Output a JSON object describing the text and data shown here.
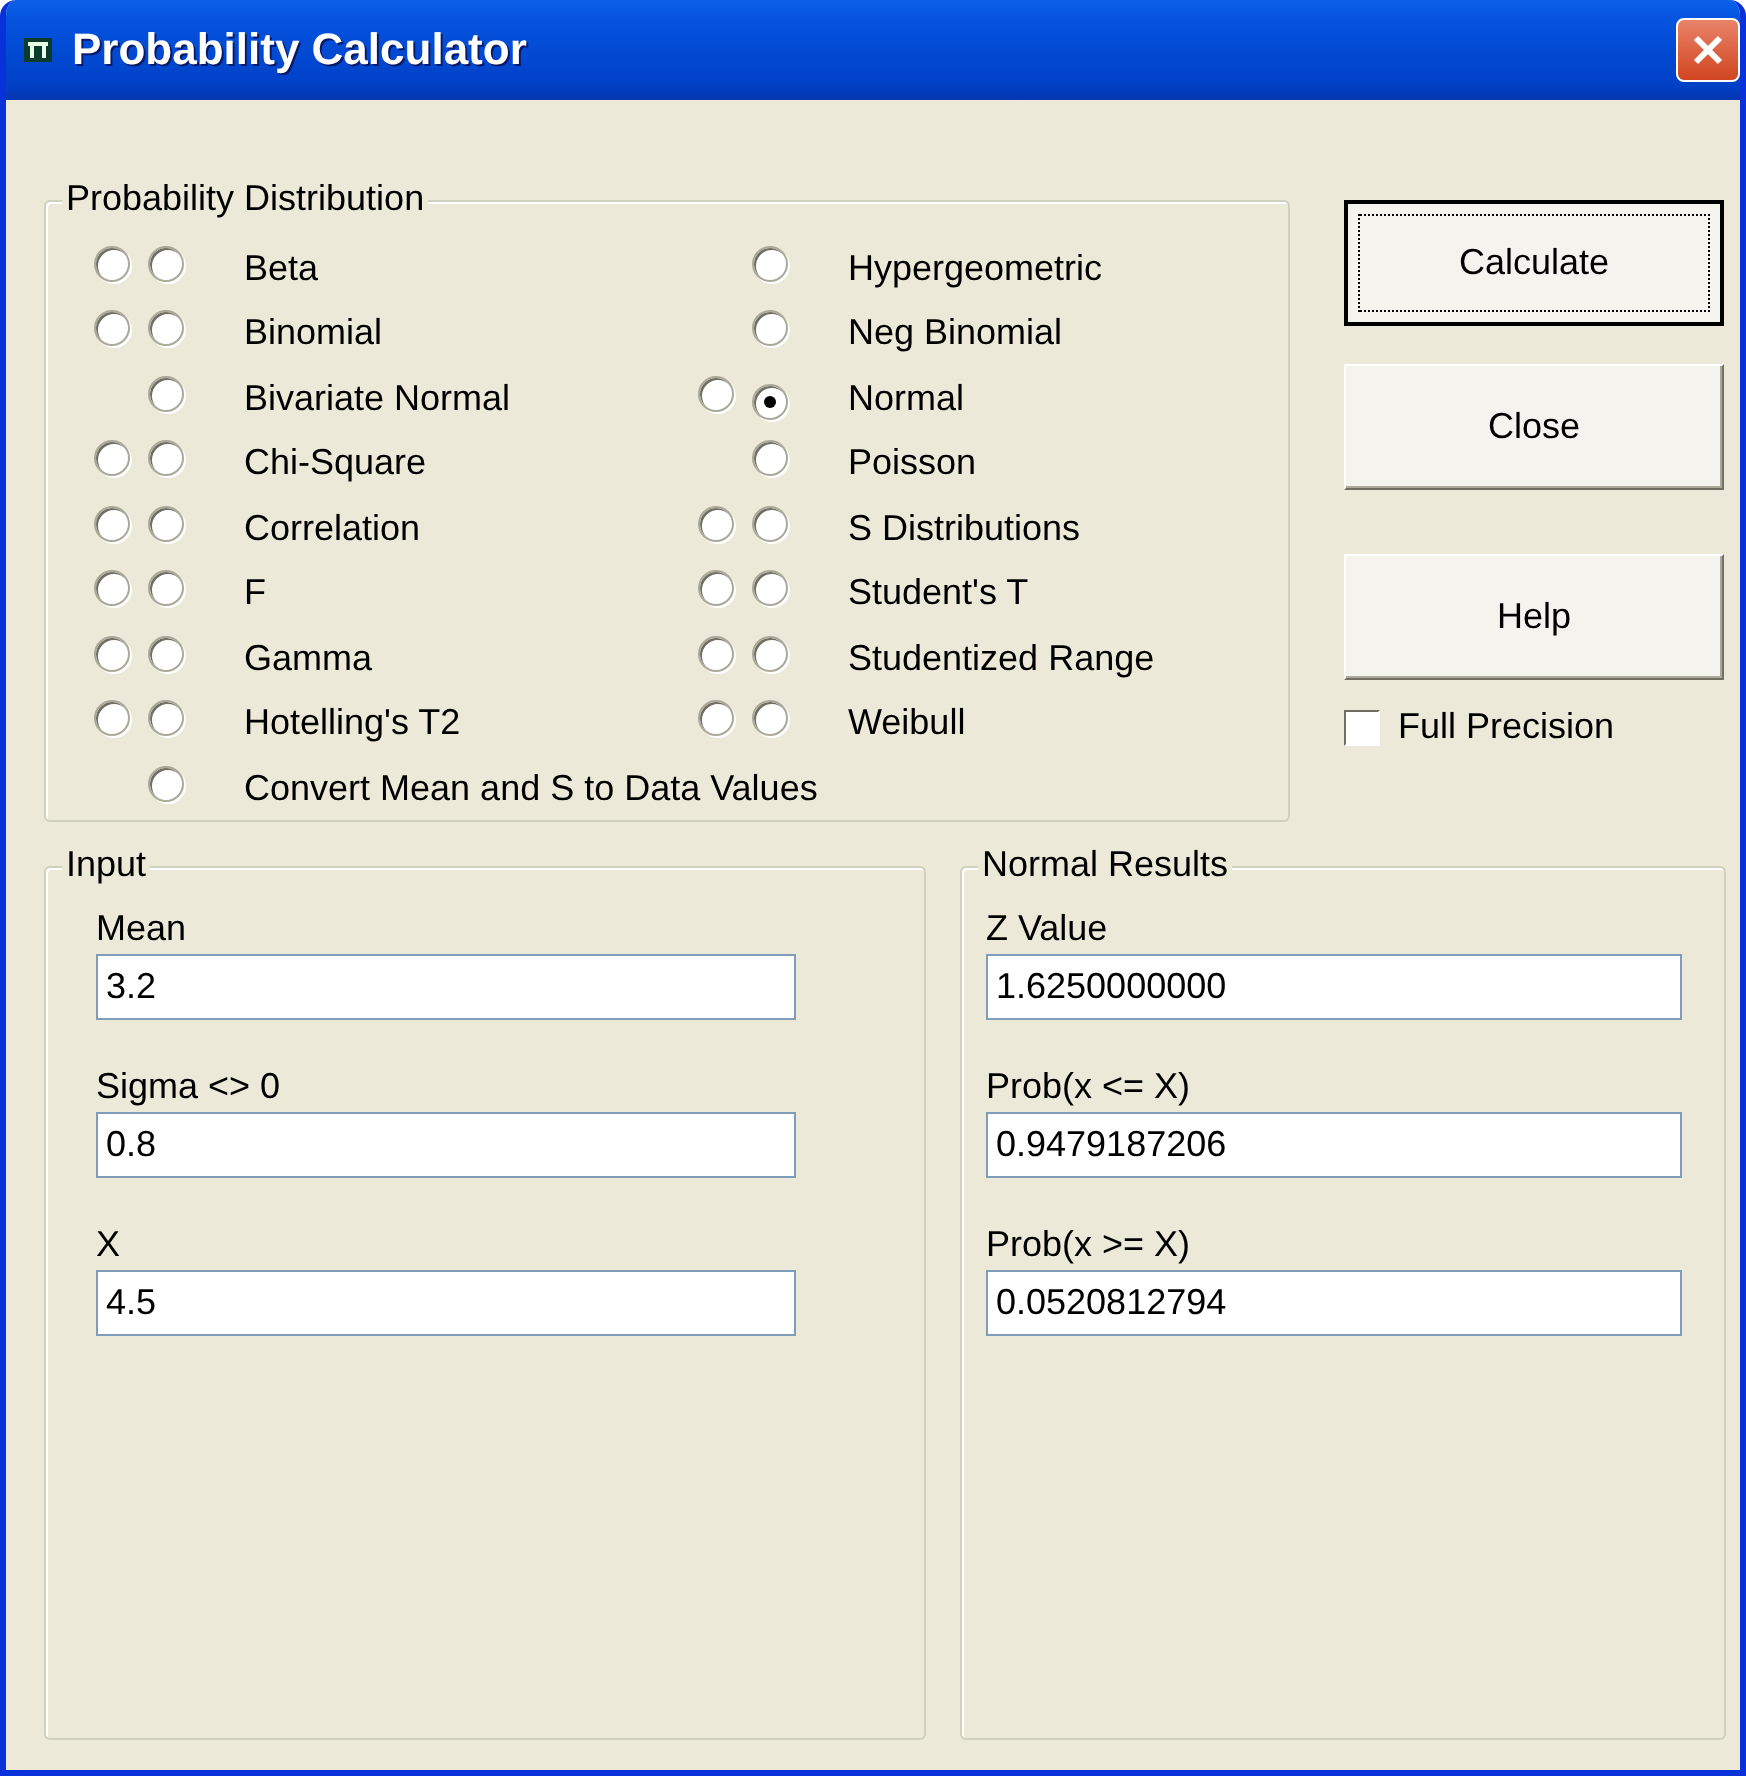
{
  "window": {
    "title": "Probability Calculator"
  },
  "distribution": {
    "title": "Probability Distribution",
    "left_column": [
      {
        "label": "Beta",
        "kind": "pair",
        "radios": [
          {
            "selected": false
          },
          {
            "selected": false
          }
        ]
      },
      {
        "label": "Binomial",
        "kind": "pair",
        "radios": [
          {
            "selected": false
          },
          {
            "selected": false
          }
        ]
      },
      {
        "label": "Bivariate Normal",
        "kind": "single",
        "radios": [
          {
            "selected": false
          }
        ]
      },
      {
        "label": "Chi-Square",
        "kind": "pair",
        "radios": [
          {
            "selected": false
          },
          {
            "selected": false
          }
        ]
      },
      {
        "label": "Correlation",
        "kind": "pair",
        "radios": [
          {
            "selected": false
          },
          {
            "selected": false
          }
        ]
      },
      {
        "label": "F",
        "kind": "pair",
        "radios": [
          {
            "selected": false
          },
          {
            "selected": false
          }
        ]
      },
      {
        "label": "Gamma",
        "kind": "pair",
        "radios": [
          {
            "selected": false
          },
          {
            "selected": false
          }
        ]
      },
      {
        "label": "Hotelling's T2",
        "kind": "pair",
        "radios": [
          {
            "selected": false
          },
          {
            "selected": false
          }
        ]
      },
      {
        "label": "Convert Mean and S to Data Values",
        "kind": "single",
        "radios": [
          {
            "selected": false
          }
        ]
      }
    ],
    "right_column": [
      {
        "label": "Hypergeometric",
        "kind": "single",
        "radios": [
          {
            "selected": false
          }
        ]
      },
      {
        "label": "Neg Binomial",
        "kind": "single",
        "radios": [
          {
            "selected": false
          }
        ]
      },
      {
        "label": "Normal",
        "kind": "pair",
        "radios": [
          {
            "selected": false
          },
          {
            "selected": true
          }
        ]
      },
      {
        "label": "Poisson",
        "kind": "single",
        "radios": [
          {
            "selected": false
          }
        ]
      },
      {
        "label": "S Distributions",
        "kind": "pair",
        "radios": [
          {
            "selected": false
          },
          {
            "selected": false
          }
        ]
      },
      {
        "label": "Student's T",
        "kind": "pair",
        "radios": [
          {
            "selected": false
          },
          {
            "selected": false
          }
        ]
      },
      {
        "label": "Studentized Range",
        "kind": "pair",
        "radios": [
          {
            "selected": false
          },
          {
            "selected": false
          }
        ]
      },
      {
        "label": "Weibull",
        "kind": "pair",
        "radios": [
          {
            "selected": false
          },
          {
            "selected": false
          }
        ]
      }
    ]
  },
  "buttons": [
    {
      "label": "Calculate",
      "default": true
    },
    {
      "label": "Close",
      "default": false
    },
    {
      "label": "Help",
      "default": false
    }
  ],
  "full_precision": {
    "label": "Full Precision",
    "checked": false
  },
  "input": {
    "title": "Input",
    "fields": [
      {
        "label": "Mean",
        "value": "3.2"
      },
      {
        "label": "Sigma <> 0",
        "value": "0.8"
      },
      {
        "label": "X",
        "value": "4.5"
      }
    ]
  },
  "results": {
    "title": "Normal Results",
    "fields": [
      {
        "label": "Z Value",
        "value": "1.6250000000"
      },
      {
        "label": "Prob(x <= X)",
        "value": "0.9479187206"
      },
      {
        "label": "Prob(x >= X)",
        "value": "0.0520812794"
      }
    ]
  }
}
